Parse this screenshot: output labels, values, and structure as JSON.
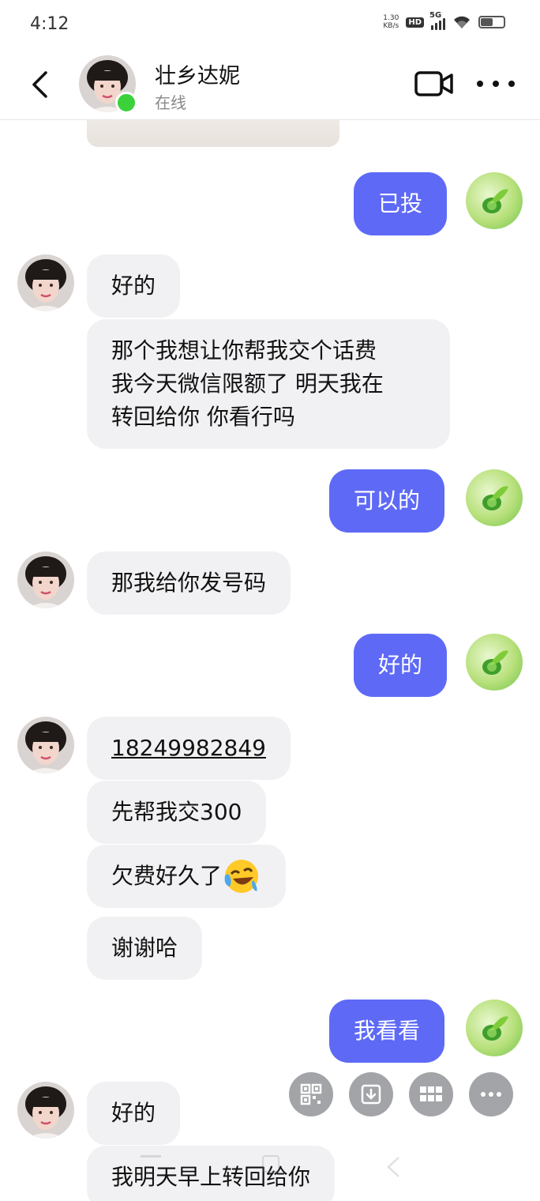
{
  "status_bar": {
    "time": "4:12",
    "net_speed_value": "1.30",
    "net_speed_unit": "KB/s",
    "hd": "HD",
    "network": "5G"
  },
  "header": {
    "contact_name": "壮乡达妮",
    "contact_status": "在线"
  },
  "messages": [
    {
      "side": "out",
      "text": "已投"
    },
    {
      "side": "in",
      "text": "好的"
    },
    {
      "side": "in",
      "lines": [
        "那个我想让你帮我交个话费",
        "我今天微信限额了 明天我在",
        "转回给你 你看行吗"
      ]
    },
    {
      "side": "out",
      "text": "可以的"
    },
    {
      "side": "in",
      "text": "那我给你发号码"
    },
    {
      "side": "out",
      "text": "好的"
    },
    {
      "side": "in",
      "text": "18249982849"
    },
    {
      "side": "in",
      "text": "先帮我交300"
    },
    {
      "side": "in",
      "text": "欠费好久了",
      "emoji": "crying-laughing-emoji"
    },
    {
      "side": "in",
      "text": "谢谢哈"
    },
    {
      "side": "out",
      "text": "我看看"
    },
    {
      "side": "in",
      "text": "好的"
    },
    {
      "side": "in",
      "text": "我明天早上转回给你"
    }
  ],
  "toolbar": {
    "icons": [
      "qr-code-icon",
      "download-icon",
      "apps-grid-icon",
      "more-icon"
    ]
  },
  "colors": {
    "outgoing_bubble": "#5e6af6",
    "incoming_bubble": "#f1f1f3",
    "online_dot": "#3bd13b"
  }
}
